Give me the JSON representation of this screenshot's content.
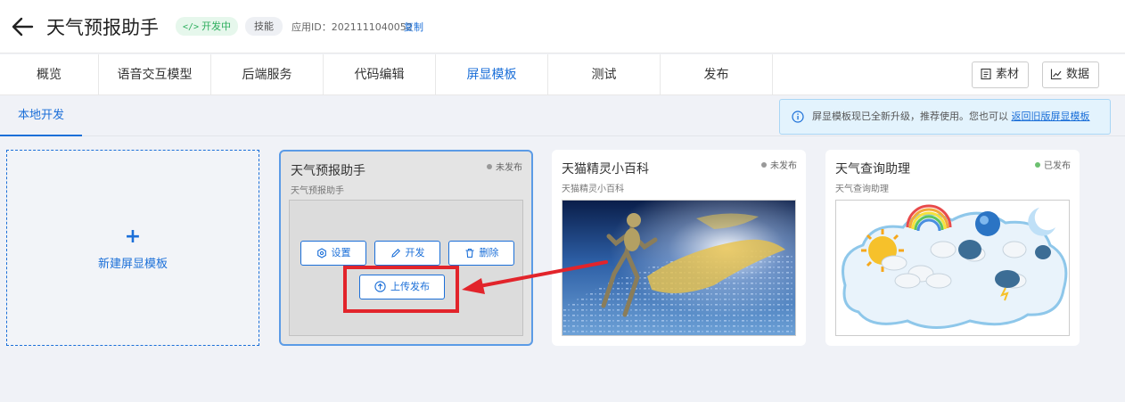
{
  "header": {
    "title": "天气预报助手",
    "dev_badge": "开发中",
    "skill_badge": "技能",
    "app_id": "应用ID：2021111040052",
    "copy": "复制"
  },
  "tabs": [
    {
      "label": "概览"
    },
    {
      "label": "语音交互模型"
    },
    {
      "label": "后端服务"
    },
    {
      "label": "代码编辑"
    },
    {
      "label": "屏显模板",
      "active": true
    },
    {
      "label": "测试"
    },
    {
      "label": "发布"
    }
  ],
  "toolbar": {
    "materials": "素材",
    "data": "数据"
  },
  "subnav": {
    "local_dev": "本地开发"
  },
  "notice": {
    "text": "屏显模板现已全新升级，推荐使用。您也可以",
    "link": "返回旧版屏显模板"
  },
  "new_card": {
    "plus": "+",
    "label": "新建屏显模板"
  },
  "cards": [
    {
      "title": "天气预报助手",
      "subtitle": "天气预报助手",
      "status": "未发布",
      "status_color": "#999999"
    },
    {
      "title": "天猫精灵小百科",
      "subtitle": "天猫精灵小百科",
      "status": "未发布",
      "status_color": "#999999"
    },
    {
      "title": "天气查询助理",
      "subtitle": "天气查询助理",
      "status": "已发布",
      "status_color": "#6cc070"
    }
  ],
  "actions": {
    "settings": "设置",
    "develop": "开发",
    "delete": "删除",
    "upload": "上传发布"
  },
  "colors": {
    "accent": "#1b6fd8",
    "highlight": "#e2242b"
  }
}
